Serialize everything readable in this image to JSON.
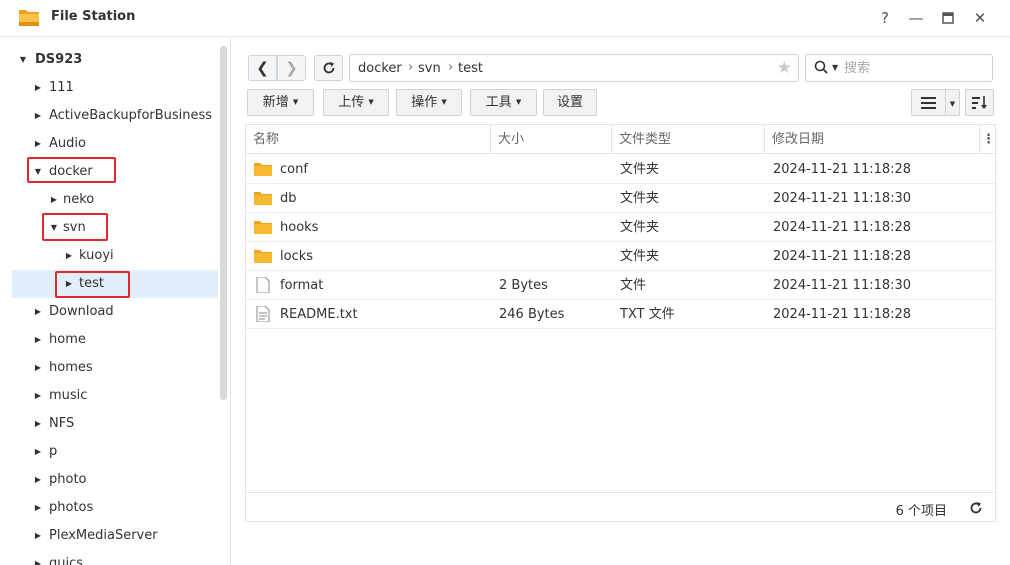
{
  "window": {
    "title": "File Station",
    "help": "?",
    "minimize": "—",
    "maximize": "▣",
    "close": "✕"
  },
  "sidebar": {
    "root": "DS923",
    "items": [
      {
        "label": "111"
      },
      {
        "label": "ActiveBackupforBusiness"
      },
      {
        "label": "Audio"
      },
      {
        "label": "docker"
      },
      {
        "label": "neko"
      },
      {
        "label": "svn"
      },
      {
        "label": "kuoyi"
      },
      {
        "label": "test"
      },
      {
        "label": "Download"
      },
      {
        "label": "home"
      },
      {
        "label": "homes"
      },
      {
        "label": "music"
      },
      {
        "label": "NFS"
      },
      {
        "label": "p"
      },
      {
        "label": "photo"
      },
      {
        "label": "photos"
      },
      {
        "label": "PlexMediaServer"
      },
      {
        "label": "quics"
      }
    ]
  },
  "toolbar": {
    "path": [
      "docker",
      "svn",
      "test"
    ],
    "path_separator": "›",
    "search_placeholder": "搜索",
    "buttons": {
      "create": "新增",
      "upload": "上传",
      "action": "操作",
      "tools": "工具",
      "settings": "设置"
    }
  },
  "table": {
    "columns": [
      "名称",
      "大小",
      "文件类型",
      "修改日期"
    ],
    "rows": [
      {
        "name": "conf",
        "size": "",
        "type": "文件夹",
        "modified": "2024-11-21 11:18:28",
        "icon": "folder-icon"
      },
      {
        "name": "db",
        "size": "",
        "type": "文件夹",
        "modified": "2024-11-21 11:18:30",
        "icon": "folder-icon"
      },
      {
        "name": "hooks",
        "size": "",
        "type": "文件夹",
        "modified": "2024-11-21 11:18:28",
        "icon": "folder-icon"
      },
      {
        "name": "locks",
        "size": "",
        "type": "文件夹",
        "modified": "2024-11-21 11:18:28",
        "icon": "folder-icon"
      },
      {
        "name": "format",
        "size": "2 Bytes",
        "type": "文件",
        "modified": "2024-11-21 11:18:30",
        "icon": "file-icon"
      },
      {
        "name": "README.txt",
        "size": "246 Bytes",
        "type": "TXT 文件",
        "modified": "2024-11-21 11:18:28",
        "icon": "text-file-icon"
      }
    ],
    "item_count": "6 个项目"
  },
  "colors": {
    "accent_selected": "#e3eefb",
    "highlight_box": "#e0282e",
    "folder": "#f5b82e"
  }
}
